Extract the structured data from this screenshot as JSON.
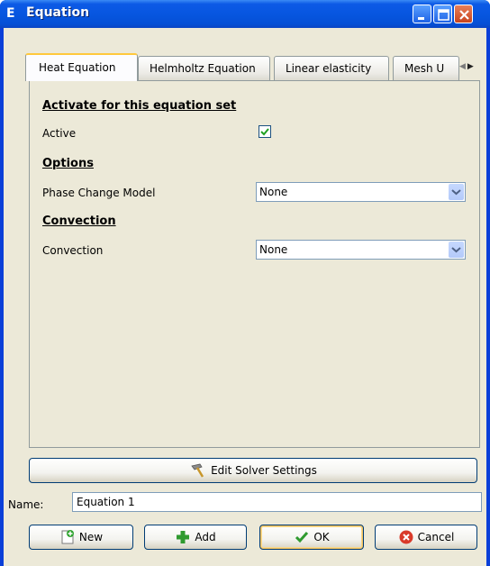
{
  "window": {
    "title": "Equation",
    "app_icon_letter": "E"
  },
  "tabs": [
    {
      "label": "Heat Equation",
      "active": true
    },
    {
      "label": "Helmholtz Equation",
      "active": false
    },
    {
      "label": "Linear elasticity",
      "active": false
    },
    {
      "label": "Mesh U",
      "active": false
    }
  ],
  "panel": {
    "section_activate": "Activate for this equation set",
    "active_label": "Active",
    "active_checked": true,
    "section_options": "Options",
    "phase_change_label": "Phase Change Model",
    "phase_change_value": "None",
    "section_convection": "Convection",
    "convection_label": "Convection",
    "convection_value": "None"
  },
  "solver_button": "Edit Solver Settings",
  "name": {
    "label": "Name:",
    "value": "Equation 1"
  },
  "buttons": {
    "new": "New",
    "add": "Add",
    "ok": "OK",
    "cancel": "Cancel"
  },
  "colors": {
    "titlebar": "#0756e0",
    "client": "#ece9d8",
    "active_tab_accent": "#ffc83c",
    "check": "#21a121"
  }
}
